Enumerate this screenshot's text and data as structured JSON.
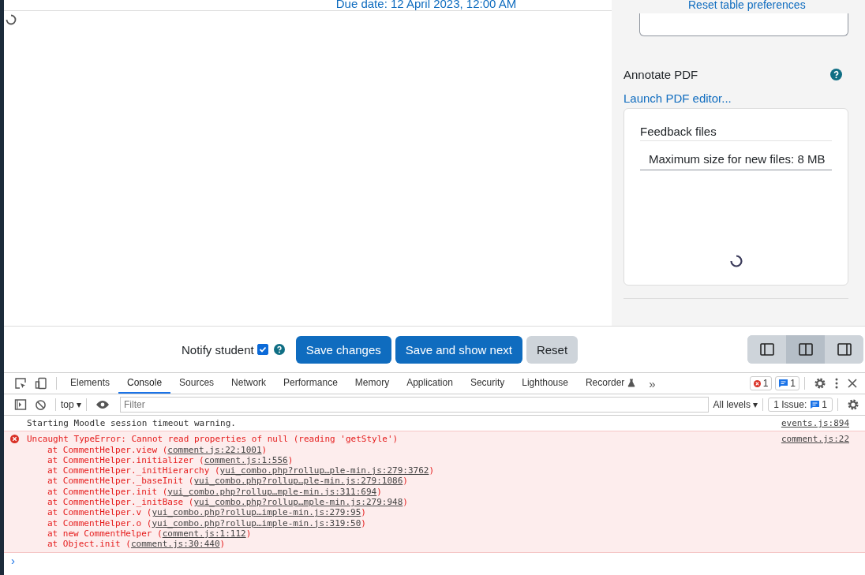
{
  "header": {
    "due_date": "Due date: 12 April 2023, 12:00 AM",
    "reset_link": "Reset table preferences"
  },
  "grading_panel": {
    "annotate_title": "Annotate PDF",
    "launch_link": "Launch PDF editor...",
    "feedback_files": {
      "title": "Feedback files",
      "max_size": "Maximum size for new files: 8 MB"
    }
  },
  "action_bar": {
    "notify_label": "Notify student",
    "notify_checked": true,
    "buttons": [
      {
        "label": "Save changes",
        "kind": "primary"
      },
      {
        "label": "Save and show next",
        "kind": "primary"
      },
      {
        "label": "Reset",
        "kind": "secondary"
      }
    ],
    "layouts": [
      {
        "kind": "left",
        "selected": false
      },
      {
        "kind": "both",
        "selected": true
      },
      {
        "kind": "right",
        "selected": false
      }
    ]
  },
  "devtools": {
    "tabs": [
      {
        "label": "Elements",
        "selected": false
      },
      {
        "label": "Console",
        "selected": true
      },
      {
        "label": "Sources",
        "selected": false
      },
      {
        "label": "Network",
        "selected": false
      },
      {
        "label": "Performance",
        "selected": false
      },
      {
        "label": "Memory",
        "selected": false
      },
      {
        "label": "Application",
        "selected": false
      },
      {
        "label": "Security",
        "selected": false
      },
      {
        "label": "Lighthouse",
        "selected": false
      },
      {
        "label": "Recorder",
        "selected": false
      }
    ],
    "more": "»",
    "error_count": "1",
    "message_count": "1",
    "context": "top ▾",
    "filter_placeholder": "Filter",
    "levels": "All levels ▾",
    "issues_label": "1 Issue:",
    "issues_count": "1",
    "messages": [
      {
        "kind": "log",
        "text": "Starting Moodle session timeout warning.",
        "source": "events.js:894"
      },
      {
        "kind": "error",
        "text": "Uncaught TypeError: Cannot read properties of null (reading 'getStyle')",
        "source": "comment.js:22",
        "stack": [
          {
            "at": "at CommentHelper.view (",
            "link": "comment.js:22:1001",
            "tail": ")"
          },
          {
            "at": "at CommentHelper.initializer (",
            "link": "comment.js:1:556",
            "tail": ")"
          },
          {
            "at": "at CommentHelper._initHierarchy (",
            "link": "yui_combo.php?rollup…ple-min.js:279:3762",
            "tail": ")"
          },
          {
            "at": "at CommentHelper._baseInit (",
            "link": "yui_combo.php?rollup…ple-min.js:279:1086",
            "tail": ")"
          },
          {
            "at": "at CommentHelper.init (",
            "link": "yui_combo.php?rollup…mple-min.js:311:694",
            "tail": ")"
          },
          {
            "at": "at CommentHelper._initBase (",
            "link": "yui_combo.php?rollup…mple-min.js:279:948",
            "tail": ")"
          },
          {
            "at": "at CommentHelper.v (",
            "link": "yui_combo.php?rollup…imple-min.js:279:95",
            "tail": ")"
          },
          {
            "at": "at CommentHelper.o (",
            "link": "yui_combo.php?rollup…imple-min.js:319:50",
            "tail": ")"
          },
          {
            "at": "at new CommentHelper (",
            "link": "comment.js:1:112",
            "tail": ")"
          },
          {
            "at": "at Object.init (",
            "link": "comment.js:30:440",
            "tail": ")"
          }
        ]
      }
    ],
    "prompt": "›"
  }
}
